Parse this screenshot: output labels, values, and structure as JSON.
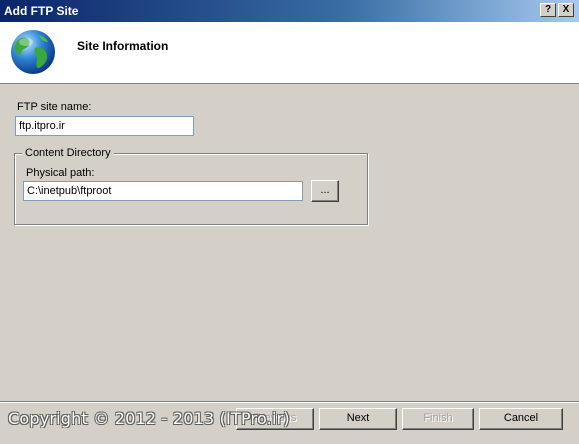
{
  "window": {
    "title": "Add FTP Site",
    "help_label": "?",
    "close_label": "X"
  },
  "header": {
    "title": "Site Information",
    "icon": "globe-icon"
  },
  "form": {
    "site_name_label": "FTP site name:",
    "site_name_value": "ftp.itpro.ir",
    "content_directory_label": "Content Directory",
    "physical_path_label": "Physical path:",
    "physical_path_value": "C:\\inetpub\\ftproot",
    "browse_label": "..."
  },
  "footer": {
    "previous_label": "Previous",
    "next_label": "Next",
    "finish_label": "Finish",
    "cancel_label": "Cancel"
  },
  "watermark": "Copyright © 2012 - 2013 (ITPro.ir)"
}
